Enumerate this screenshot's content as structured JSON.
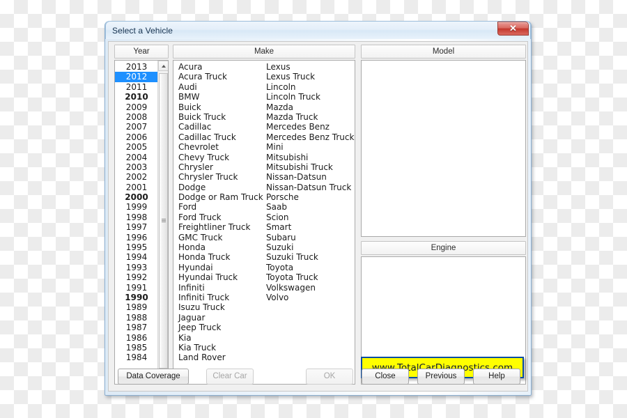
{
  "window": {
    "title": "Select a Vehicle",
    "close_glyph": "✕"
  },
  "panels": {
    "year_label": "Year",
    "make_label": "Make",
    "model_label": "Model",
    "engine_label": "Engine"
  },
  "year_list": {
    "selected": "2012",
    "bold": [
      "2010",
      "2000",
      "1990"
    ],
    "items": [
      "2013",
      "2012",
      "2011",
      "2010",
      "2009",
      "2008",
      "2007",
      "2006",
      "2005",
      "2004",
      "2003",
      "2002",
      "2001",
      "2000",
      "1999",
      "1998",
      "1997",
      "1996",
      "1995",
      "1994",
      "1993",
      "1992",
      "1991",
      "1990",
      "1989",
      "1988",
      "1987",
      "1986",
      "1985",
      "1984"
    ]
  },
  "make_list": {
    "column_1": [
      "Acura",
      "Acura Truck",
      "Audi",
      "BMW",
      "Buick",
      "Buick Truck",
      "Cadillac",
      "Cadillac Truck",
      "Chevrolet",
      "Chevy Truck",
      "Chrysler",
      "Chrysler Truck",
      "Dodge",
      "Dodge or Ram Truck",
      "Ford",
      "Ford Truck",
      "Freightliner Truck",
      "GMC Truck",
      "Honda",
      "Honda Truck",
      "Hyundai",
      "Hyundai Truck",
      "Infiniti",
      "Infiniti Truck",
      "Isuzu Truck",
      "Jaguar",
      "Jeep Truck",
      "Kia",
      "Kia Truck",
      "Land Rover"
    ],
    "column_2": [
      "Lexus",
      "Lexus Truck",
      "Lincoln",
      "Lincoln Truck",
      "Mazda",
      "Mazda Truck",
      "Mercedes Benz",
      "Mercedes Benz Truck",
      "Mini",
      "Mitsubishi",
      "Mitsubishi Truck",
      "Nissan-Datsun",
      "Nissan-Datsun Truck",
      "Porsche",
      "Saab",
      "Scion",
      "Smart",
      "Subaru",
      "Suzuki",
      "Suzuki Truck",
      "Toyota",
      "Toyota Truck",
      "Volkswagen",
      "Volvo"
    ]
  },
  "model_list": {
    "items": []
  },
  "engine_list": {
    "items": []
  },
  "banner": {
    "text": "www.TotalCarDiagnostics.com",
    "background_color": "#ffff00",
    "border_color": "#0b4da2",
    "text_color": "#0e1a33"
  },
  "buttons": {
    "data_coverage": "Data Coverage",
    "clear_car": "Clear Car",
    "ok": "OK",
    "close": "Close",
    "previous": "Previous",
    "help": "Help"
  },
  "colors": {
    "selection_blue": "#1e90ff",
    "close_button_red": "#c4372d",
    "window_chrome": "#d8e8f6"
  }
}
